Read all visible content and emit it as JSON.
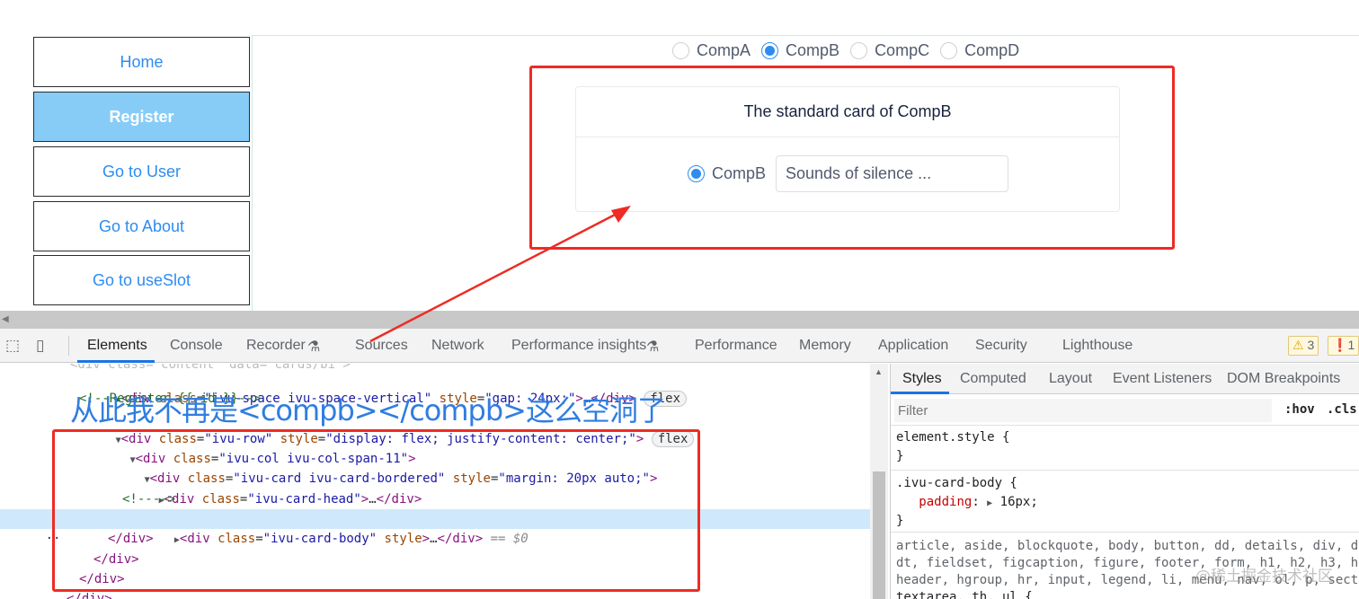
{
  "app": {
    "nav": [
      {
        "label": "Home",
        "active": false
      },
      {
        "label": "Register",
        "active": true
      },
      {
        "label": "Go to User",
        "active": false
      },
      {
        "label": "Go to About",
        "active": false
      },
      {
        "label": "Go to useSlot",
        "active": false
      }
    ],
    "radios": [
      {
        "label": "CompA",
        "checked": false
      },
      {
        "label": "CompB",
        "checked": true
      },
      {
        "label": "CompC",
        "checked": false
      },
      {
        "label": "CompD",
        "checked": false
      }
    ],
    "card": {
      "head": "The standard card of CompB",
      "radio_label": "CompB",
      "input_value": "Sounds of silence ..."
    }
  },
  "devtools": {
    "tabs": [
      "Elements",
      "Console",
      "Recorder",
      "Sources",
      "Network",
      "Performance insights",
      "Performance",
      "Memory",
      "Application",
      "Security",
      "Lighthouse"
    ],
    "active_tab": "Elements",
    "warnings": "3",
    "issues": "1",
    "elements": {
      "lines": [
        {
          "raw": "<div class=\"ivu-space ivu-space-vertical\" style=\"gap: 24px;\">…</div>",
          "pill": "flex"
        },
        {
          "raw": "<!--Register {{ id }}-->"
        },
        {
          "raw": "<div class=\"ivu-row\" style=\"display: flex; justify-content: center;\">",
          "pill": "flex"
        },
        {
          "raw": "<div class=\"ivu-col ivu-col-span-11\">"
        },
        {
          "raw": "<div class=\"ivu-card ivu-card-bordered\" style=\"margin: 20px auto;\">"
        },
        {
          "raw": "<div class=\"ivu-card-head\">…</div>"
        },
        {
          "raw": "<!---->"
        },
        {
          "raw": "<div class=\"ivu-card-body\" style>…</div>",
          "suffix": "== $0"
        },
        {
          "raw": "</div>"
        },
        {
          "raw": "</div>"
        },
        {
          "raw": "</div>"
        },
        {
          "raw": "</div>"
        }
      ]
    },
    "styles": {
      "tabs": [
        "Styles",
        "Computed",
        "Layout",
        "Event Listeners",
        "DOM Breakpoints"
      ],
      "filter_placeholder": "Filter",
      "hov": ":hov",
      "cls": ".cls",
      "element_style": "element.style {",
      "close_brace": "}",
      "rule_selector": ".ivu-card-body {",
      "rule_prop": "padding",
      "rule_value": "16px;",
      "inherited_1": "article, aside, blockquote, body, button, dd, details, div, d",
      "inherited_2": "dt, fieldset, figcaption, figure, footer, form, h1, h2, h3, h",
      "inherited_3": "header, hgroup, hr, input, legend, li, menu, nav, ol, p, sect",
      "inherited_4": "textarea, th, ul {"
    }
  },
  "annotation": {
    "text": "从此我不再是<compb></compb>这么空洞了",
    "color": "#2f7de1",
    "box_color": "#ee2b24"
  },
  "watermark": "@稀土掘金技术社区",
  "colors": {
    "link": "#2d8cf0",
    "nav_active_bg": "#87ccf7",
    "selection": "#cfe8fc"
  }
}
